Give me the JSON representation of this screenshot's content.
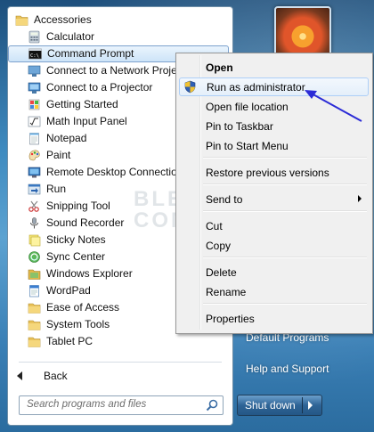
{
  "programs": [
    {
      "label": "Accessories",
      "icon": "folder-icon",
      "type": "folder"
    },
    {
      "label": "Calculator",
      "icon": "calculator-icon"
    },
    {
      "label": "Command Prompt",
      "icon": "command-prompt-icon",
      "selected": true
    },
    {
      "label": "Connect to a Network Projector",
      "icon": "network-projector-icon"
    },
    {
      "label": "Connect to a Projector",
      "icon": "projector-icon"
    },
    {
      "label": "Getting Started",
      "icon": "getting-started-icon"
    },
    {
      "label": "Math Input Panel",
      "icon": "math-input-icon"
    },
    {
      "label": "Notepad",
      "icon": "notepad-icon"
    },
    {
      "label": "Paint",
      "icon": "paint-icon"
    },
    {
      "label": "Remote Desktop Connection",
      "icon": "remote-desktop-icon"
    },
    {
      "label": "Run",
      "icon": "run-icon"
    },
    {
      "label": "Snipping Tool",
      "icon": "snipping-tool-icon"
    },
    {
      "label": "Sound Recorder",
      "icon": "microphone-icon"
    },
    {
      "label": "Sticky Notes",
      "icon": "sticky-notes-icon"
    },
    {
      "label": "Sync Center",
      "icon": "sync-icon"
    },
    {
      "label": "Windows Explorer",
      "icon": "folder-explorer-icon"
    },
    {
      "label": "WordPad",
      "icon": "wordpad-icon"
    },
    {
      "label": "Ease of Access",
      "icon": "folder-icon",
      "type": "folder"
    },
    {
      "label": "System Tools",
      "icon": "folder-icon",
      "type": "folder"
    },
    {
      "label": "Tablet PC",
      "icon": "folder-icon",
      "type": "folder"
    }
  ],
  "back_label": "Back",
  "search": {
    "placeholder": "Search programs and files"
  },
  "right_links": {
    "default_programs": "Default Programs",
    "help_support": "Help and Support"
  },
  "shutdown_label": "Shut down",
  "context_menu": {
    "open": "Open",
    "run_as_admin": "Run as administrator",
    "open_file_location": "Open file location",
    "pin_taskbar": "Pin to Taskbar",
    "pin_start": "Pin to Start Menu",
    "restore": "Restore previous versions",
    "send_to": "Send to",
    "cut": "Cut",
    "copy": "Copy",
    "delete": "Delete",
    "rename": "Rename",
    "properties": "Properties"
  },
  "watermark": {
    "line1": "BLEEPING",
    "line2": "COMPUTER"
  },
  "colors": {
    "accent": "#2b2bd6",
    "highlight_border": "#aecff7",
    "taskbar_blue": "#3a7fb5"
  }
}
